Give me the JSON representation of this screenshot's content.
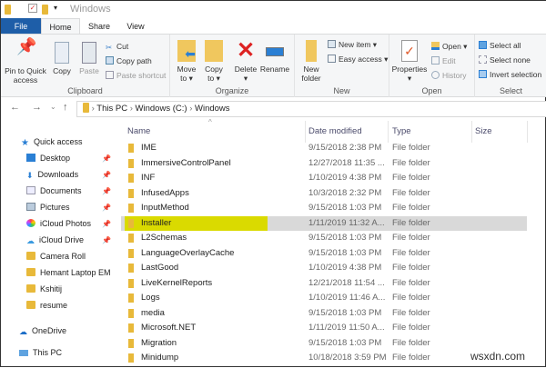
{
  "window": {
    "title": "Windows"
  },
  "tabs": [
    {
      "label": "File"
    },
    {
      "label": "Home"
    },
    {
      "label": "Share"
    },
    {
      "label": "View"
    }
  ],
  "ribbon": {
    "clipboard": {
      "label": "Clipboard",
      "pin": "Pin to Quick access",
      "copy": "Copy",
      "paste": "Paste",
      "cut": "Cut",
      "copy_path": "Copy path",
      "paste_shortcut": "Paste shortcut"
    },
    "organize": {
      "label": "Organize",
      "move_to": "Move to",
      "copy_to": "Copy to",
      "delete": "Delete",
      "rename": "Rename"
    },
    "new": {
      "label": "New",
      "new_folder": "New folder",
      "new_item": "New item",
      "easy_access": "Easy access"
    },
    "open": {
      "label": "Open",
      "properties": "Properties",
      "open": "Open",
      "edit": "Edit",
      "history": "History"
    },
    "select": {
      "label": "Select",
      "select_all": "Select all",
      "select_none": "Select none",
      "invert": "Invert selection"
    }
  },
  "breadcrumb": [
    "This PC",
    "Windows (C:)",
    "Windows"
  ],
  "sidebar": {
    "quick_access": "Quick access",
    "items": [
      {
        "label": "Desktop",
        "pinned": true
      },
      {
        "label": "Downloads",
        "pinned": true
      },
      {
        "label": "Documents",
        "pinned": true
      },
      {
        "label": "Pictures",
        "pinned": true
      },
      {
        "label": "iCloud Photos",
        "pinned": true
      },
      {
        "label": "iCloud Drive",
        "pinned": true
      },
      {
        "label": "Camera Roll"
      },
      {
        "label": "Hemant Laptop EM"
      },
      {
        "label": "Kshitij"
      },
      {
        "label": "resume"
      }
    ],
    "onedrive": "OneDrive",
    "this_pc": "This PC"
  },
  "columns": {
    "name": "Name",
    "date": "Date modified",
    "type": "Type",
    "size": "Size"
  },
  "files": [
    {
      "name": "IME",
      "date": "9/15/2018 2:38 PM",
      "type": "File folder"
    },
    {
      "name": "ImmersiveControlPanel",
      "date": "12/27/2018 11:35 ...",
      "type": "File folder"
    },
    {
      "name": "INF",
      "date": "1/10/2019 4:38 PM",
      "type": "File folder"
    },
    {
      "name": "InfusedApps",
      "date": "10/3/2018 2:32 PM",
      "type": "File folder"
    },
    {
      "name": "InputMethod",
      "date": "9/15/2018 1:03 PM",
      "type": "File folder"
    },
    {
      "name": "Installer",
      "date": "1/11/2019 11:32 A...",
      "type": "File folder",
      "selected": true
    },
    {
      "name": "L2Schemas",
      "date": "9/15/2018 1:03 PM",
      "type": "File folder"
    },
    {
      "name": "LanguageOverlayCache",
      "date": "9/15/2018 1:03 PM",
      "type": "File folder"
    },
    {
      "name": "LastGood",
      "date": "1/10/2019 4:38 PM",
      "type": "File folder"
    },
    {
      "name": "LiveKernelReports",
      "date": "12/21/2018 11:54 ...",
      "type": "File folder"
    },
    {
      "name": "Logs",
      "date": "1/10/2019 11:46 A...",
      "type": "File folder"
    },
    {
      "name": "media",
      "date": "9/15/2018 1:03 PM",
      "type": "File folder"
    },
    {
      "name": "Microsoft.NET",
      "date": "1/11/2019 11:50 A...",
      "type": "File folder"
    },
    {
      "name": "Migration",
      "date": "9/15/2018 1:03 PM",
      "type": "File folder"
    },
    {
      "name": "Minidump",
      "date": "10/18/2018 3:59 PM",
      "type": "File folder"
    }
  ],
  "watermark": "wsxdn.com",
  "colors": {
    "file_tab": "#1e5ea8",
    "highlight": "#dada00",
    "selection": "#d9d9d9"
  }
}
